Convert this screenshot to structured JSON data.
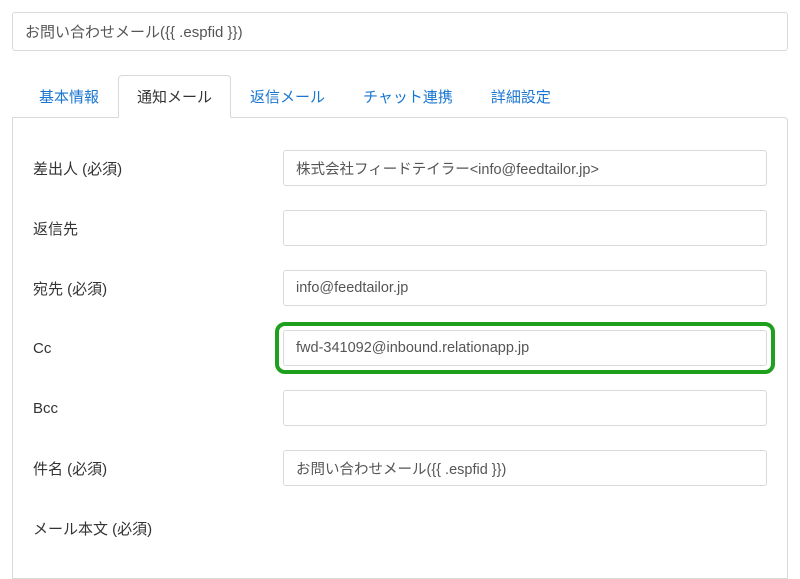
{
  "title_field": {
    "value": "お問い合わせメール({{ .espfid }})"
  },
  "tabs": [
    {
      "label": "基本情報",
      "active": false
    },
    {
      "label": "通知メール",
      "active": true
    },
    {
      "label": "返信メール",
      "active": false
    },
    {
      "label": "チャット連携",
      "active": false
    },
    {
      "label": "詳細設定",
      "active": false
    }
  ],
  "form": {
    "sender": {
      "label": "差出人 (必須)",
      "value": "株式会社フィードテイラー<info@feedtailor.jp>"
    },
    "reply_to": {
      "label": "返信先",
      "value": ""
    },
    "to": {
      "label": "宛先 (必須)",
      "value": "info@feedtailor.jp"
    },
    "cc": {
      "label": "Cc",
      "value": "fwd-341092@inbound.relationapp.jp",
      "highlighted": true
    },
    "bcc": {
      "label": "Bcc",
      "value": ""
    },
    "subject": {
      "label": "件名 (必須)",
      "value": "お問い合わせメール({{ .espfid }})"
    },
    "body": {
      "label": "メール本文 (必須)"
    }
  }
}
